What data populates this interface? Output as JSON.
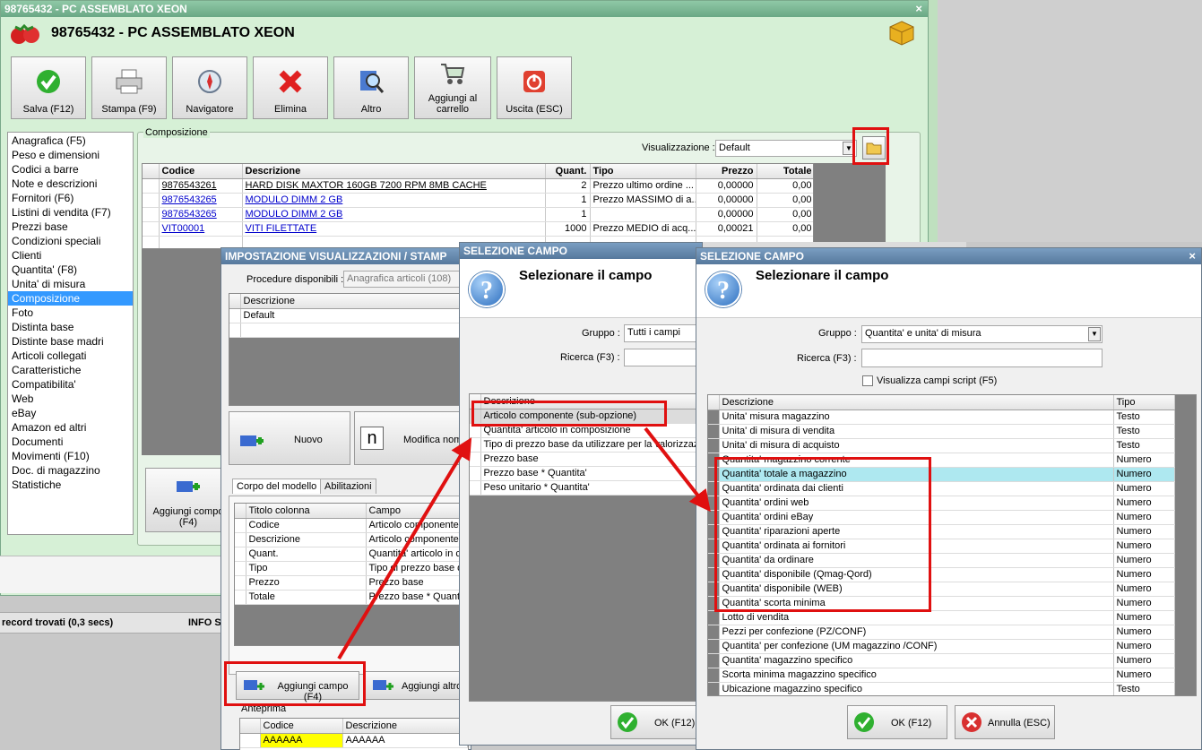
{
  "main_window": {
    "titlebar": "98765432 - PC ASSEMBLATO XEON",
    "header_title": "98765432 - PC ASSEMBLATO XEON",
    "toolbar": {
      "save": "Salva (F12)",
      "print": "Stampa (F9)",
      "navigator": "Navigatore",
      "delete": "Elimina",
      "other": "Altro",
      "add_cart_1": "Aggiungi al",
      "add_cart_2": "carrello",
      "exit": "Uscita (ESC)"
    },
    "sidebar": [
      "Anagrafica (F5)",
      "Peso e dimensioni",
      "Codici a barre",
      "Note e descrizioni",
      "Fornitori (F6)",
      "Listini di vendita (F7)",
      "Prezzi base",
      "Condizioni speciali",
      "Clienti",
      "Quantita' (F8)",
      "Unita' di misura",
      "Composizione",
      "Foto",
      "Distinta base",
      "Distinte base madri",
      "Articoli collegati",
      "Caratteristiche",
      "Compatibilita'",
      "Web",
      "eBay",
      "Amazon ed altri",
      "Documenti",
      "Movimenti (F10)",
      "Doc. di magazzino",
      "Statistiche"
    ],
    "selected_sidebar_item": "Composizione",
    "composition_label": "Composizione",
    "view_label": "Visualizzazione :",
    "view_value": "Default",
    "grid_headers": [
      "Codice",
      "Descrizione",
      "Quant.",
      "Tipo",
      "Prezzo",
      "Totale"
    ],
    "grid_rows": [
      [
        "9876543261",
        "HARD DISK MAXTOR 160GB 7200 RPM 8MB CACHE",
        "2",
        "Prezzo ultimo ordine ...",
        "0,00000",
        "0,00"
      ],
      [
        "9876543265",
        "MODULO DIMM 2 GB",
        "1",
        "Prezzo MASSIMO di a...",
        "0,00000",
        "0,00"
      ],
      [
        "9876543265",
        "MODULO DIMM 2 GB",
        "1",
        "",
        "0,00000",
        "0,00"
      ],
      [
        "VIT00001",
        "VITI FILETTATE",
        "1000",
        "Prezzo MEDIO di acq...",
        "0,00021",
        "0,00"
      ]
    ],
    "add_component_1": "Aggiungi compo",
    "add_component_2": "(F4)",
    "status_records": "record trovati (0,3 secs)",
    "status_info": "INFO S"
  },
  "settings_window": {
    "title": "IMPOSTAZIONE VISUALIZZAZIONI / STAMP",
    "procedures_label": "Procedure disponibili :",
    "procedures_value": "Anagrafica articoli (108)",
    "desc_header": "Descrizione",
    "desc_row": "Default",
    "new_button": "Nuovo",
    "edit_button": "Modifica nom",
    "edit_glyph": "n",
    "tabs": [
      "Corpo del modello",
      "Abilitazioni"
    ],
    "column_headers": [
      "Titolo colonna",
      "Campo"
    ],
    "column_rows": [
      [
        "Codice",
        "Articolo componente"
      ],
      [
        "Descrizione",
        "Articolo componente"
      ],
      [
        "Quant.",
        "Quantita' articolo in c"
      ],
      [
        "Tipo",
        "Tipo di prezzo base d"
      ],
      [
        "Prezzo",
        "Prezzo base"
      ],
      [
        "Totale",
        "Prezzo base * Quanti"
      ]
    ],
    "add_field_button": "Aggiungi campo (F4)",
    "add_other_button": "Aggiungi altro",
    "preview_label": "Anteprima",
    "preview_headers": [
      "Codice",
      "Descrizione"
    ],
    "preview_row": [
      "AAAAAA",
      "AAAAAA"
    ]
  },
  "field_select_1": {
    "title": "SELEZIONE CAMPO",
    "heading": "Selezionare il campo",
    "group_label": "Gruppo :",
    "group_value": "Tutti i campi",
    "search_label": "Ricerca (F3) :",
    "desc_header": "Descrizione",
    "rows": [
      "Articolo componente (sub-opzione)",
      "Quantita' articolo in composizione",
      "Tipo di prezzo base da utilizzare per la valorizzazione",
      "Prezzo base",
      "Prezzo base * Quantita'",
      "Peso unitario * Quantita'"
    ],
    "ok_button": "OK (F12)"
  },
  "field_select_2": {
    "title": "SELEZIONE CAMPO",
    "heading": "Selezionare il campo",
    "group_label": "Gruppo :",
    "group_value": "Quantita' e unita' di misura",
    "search_label": "Ricerca (F3) :",
    "script_checkbox": "Visualizza campi script (F5)",
    "headers": [
      "Descrizione",
      "Tipo"
    ],
    "rows": [
      [
        "Unita' misura magazzino",
        "Testo"
      ],
      [
        "Unita' di misura di vendita",
        "Testo"
      ],
      [
        "Unita' di misura di acquisto",
        "Testo"
      ],
      [
        "Quantita' magazzino corrente",
        "Numero"
      ],
      [
        "Quantita' totale a magazzino",
        "Numero"
      ],
      [
        "Quantita' ordinata dai clienti",
        "Numero"
      ],
      [
        "Quantita' ordini web",
        "Numero"
      ],
      [
        "Quantita' ordini eBay",
        "Numero"
      ],
      [
        "Quantita' riparazioni aperte",
        "Numero"
      ],
      [
        "Quantita' ordinata ai fornitori",
        "Numero"
      ],
      [
        "Quantita' da ordinare",
        "Numero"
      ],
      [
        "Quantita' disponibile (Qmag-Qord)",
        "Numero"
      ],
      [
        "Quantita' disponibile (WEB)",
        "Numero"
      ],
      [
        "Quantita' scorta minima",
        "Numero"
      ],
      [
        "Lotto di vendita",
        "Numero"
      ],
      [
        "Pezzi per confezione (PZ/CONF)",
        "Numero"
      ],
      [
        "Quantita' per confezione (UM magazzino /CONF)",
        "Numero"
      ],
      [
        "Quantita' magazzino specifico",
        "Numero"
      ],
      [
        "Scorta minima magazzino specifico",
        "Numero"
      ],
      [
        "Ubicazione magazzino specifico",
        "Testo"
      ]
    ],
    "selected_row": "Quantita' totale a magazzino",
    "ok_button": "OK (F12)",
    "cancel_button": "Annulla (ESC)"
  },
  "colors": {
    "accent_red": "#e01010",
    "selection_blue": "#3399ff",
    "row_highlight": "#aee8f0",
    "window_green": "#d8f2d8"
  }
}
